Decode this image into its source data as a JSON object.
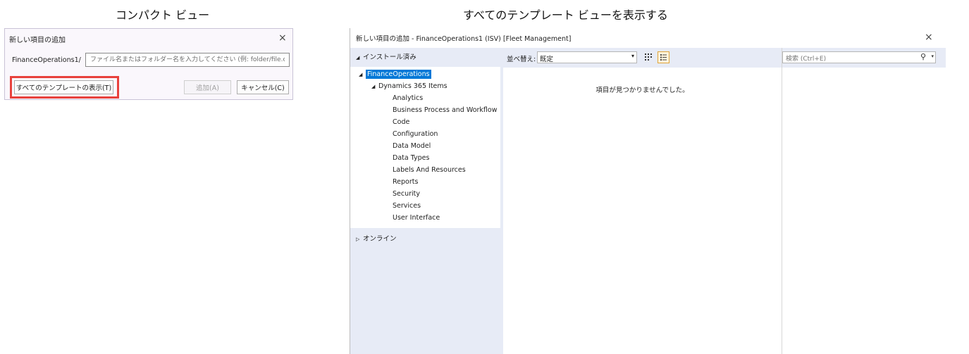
{
  "captions": {
    "compact": "コンパクト ビュー",
    "full": "すべてのテンプレート ビューを表示する"
  },
  "compact_dialog": {
    "title": "新しい項目の追加",
    "close_icon": "×",
    "prefix": "FinanceOperations1/",
    "path_placeholder": "ファイル名またはフォルダー名を入力してください (例: folder/file.cs)",
    "show_all_templates": "すべてのテンプレートの表示(T)",
    "add": "追加(A)",
    "cancel": "キャンセル(C)",
    "highlight_color": "#e8413c"
  },
  "full_dialog": {
    "title": "新しい項目の追加 - FinanceOperations1 (ISV) [Fleet Management]",
    "close_icon": "×",
    "installed_header": "インストール済み",
    "tree": {
      "root": "FinanceOperations",
      "group": "Dynamics 365 Items",
      "children": [
        "Analytics",
        "Business Process and Workflow",
        "Code",
        "Configuration",
        "Data Model",
        "Data Types",
        "Labels And Resources",
        "Reports",
        "Security",
        "Services",
        "User Interface"
      ]
    },
    "online_header": "オンライン",
    "sort_label": "並べ替え:",
    "sort_value": "既定",
    "empty_message": "項目が見つかりませんでした。",
    "search_placeholder": "検索 (Ctrl+E)",
    "icons": {
      "expanded": "◢",
      "collapsed": "▷",
      "dropdown": "▾",
      "search": "⚲"
    },
    "colors": {
      "selection": "#0078d7",
      "panel": "#e7ebf6"
    }
  }
}
